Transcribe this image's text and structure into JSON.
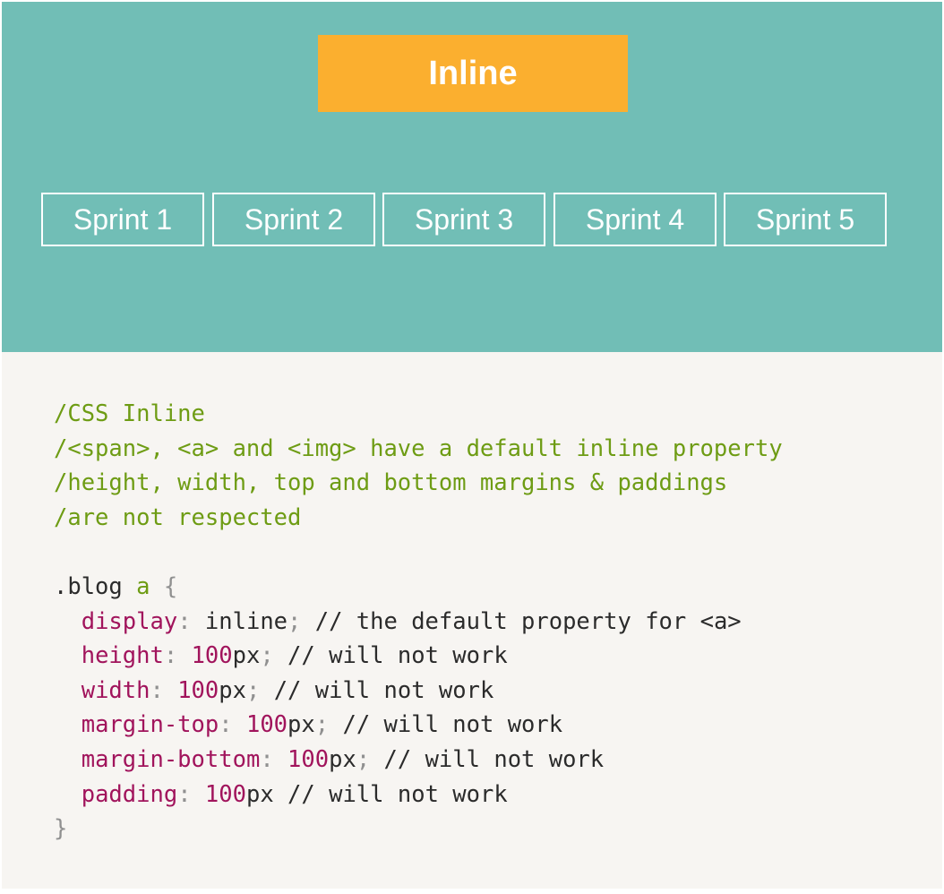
{
  "demo": {
    "title": "Inline",
    "sprints": [
      "Sprint 1",
      "Sprint 2",
      "Sprint 3",
      "Sprint 4",
      "Sprint 5"
    ],
    "colors": {
      "background": "#71beb6",
      "title_box": "#fbaf2f",
      "text": "#ffffff"
    }
  },
  "code": {
    "comments": [
      "/CSS Inline",
      "/<span>, <a> and <img> have a default inline property",
      "/height, width, top and bottom margins & paddings",
      "/are not respected"
    ],
    "selector": ".blog",
    "selector_tag": "a",
    "open_brace": "{",
    "close_brace": "}",
    "declarations": [
      {
        "property": "display",
        "value": "inline",
        "number": "",
        "unit": "",
        "semicolon": ";",
        "comment": " // the default property for <a>"
      },
      {
        "property": "height",
        "value": "",
        "number": "100",
        "unit": "px",
        "semicolon": ";",
        "comment": " // will not work"
      },
      {
        "property": "width",
        "value": "",
        "number": "100",
        "unit": "px",
        "semicolon": ";",
        "comment": " // will not work"
      },
      {
        "property": "margin-top",
        "value": "",
        "number": "100",
        "unit": "px",
        "semicolon": ";",
        "comment": " // will not work"
      },
      {
        "property": "margin-bottom",
        "value": "",
        "number": "100",
        "unit": "px",
        "semicolon": ";",
        "comment": " // will not work"
      },
      {
        "property": "padding",
        "value": "",
        "number": "100",
        "unit": "px",
        "semicolon": "",
        "comment": " // will not work"
      }
    ],
    "colors": {
      "comment": "#6e9c14",
      "property": "#a1145c",
      "text": "#2b2b2b",
      "punctuation": "#909090",
      "background": "#f7f5f2"
    }
  }
}
